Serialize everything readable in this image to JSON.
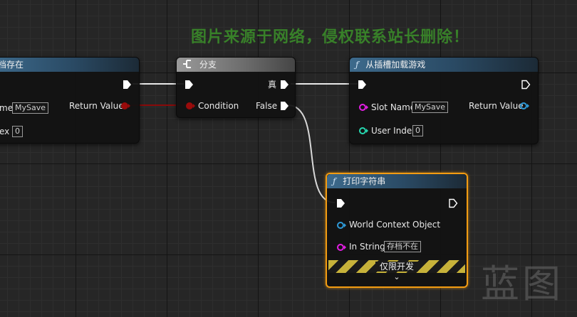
{
  "watermark": {
    "top_text": "图片来源于网络，侵权联系站长删除！",
    "corner_text": "蓝图"
  },
  "node_left": {
    "title": "档存在",
    "slot_name_label": "me",
    "slot_name_value": "MySave",
    "user_index_label": "ex",
    "user_index_value": "0",
    "return_value_label": "Return Value"
  },
  "node_branch": {
    "title": "分支",
    "condition_label": "Condition",
    "true_label": "真",
    "false_label": "False"
  },
  "node_load": {
    "title": "从插槽加载游戏",
    "glyph": "ƒ",
    "slot_name_label": "Slot Name",
    "slot_name_value": "MySave",
    "user_index_label": "User Index",
    "user_index_value": "0",
    "return_value_label": "Return Value"
  },
  "node_print": {
    "title": "打印字符串",
    "glyph": "ƒ",
    "world_context_label": "World Context Object",
    "in_string_label": "In String",
    "in_string_value": "存档不在",
    "dev_only_label": "仅限开发",
    "expand_glyph": "⌄"
  },
  "colors": {
    "exec": "#ffffff",
    "bool_pin": "#9a0b0b",
    "object_pin": "#2e9ad8",
    "string_pin": "#e41ee4",
    "int_pin": "#26d8b0",
    "selection": "#f39c12"
  },
  "icons": {
    "function": "f-function-icon",
    "branch": "branch-icon",
    "exec": "exec-pin-icon"
  }
}
